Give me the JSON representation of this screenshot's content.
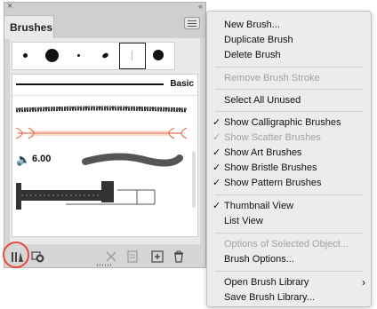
{
  "panel": {
    "tab_label": "Brushes",
    "basic_label": "Basic",
    "stroke_size": "6.00"
  },
  "menu": {
    "items": [
      {
        "label": "New Brush...",
        "enabled": true,
        "checked": false
      },
      {
        "label": "Duplicate Brush",
        "enabled": true,
        "checked": false
      },
      {
        "label": "Delete Brush",
        "enabled": true,
        "checked": false
      },
      {
        "label": "Remove Brush Stroke",
        "enabled": false,
        "checked": false
      },
      {
        "label": "Select All Unused",
        "enabled": true,
        "checked": false
      },
      {
        "label": "Show Calligraphic Brushes",
        "enabled": true,
        "checked": true
      },
      {
        "label": "Show Scatter Brushes",
        "enabled": false,
        "checked": true
      },
      {
        "label": "Show Art Brushes",
        "enabled": true,
        "checked": true
      },
      {
        "label": "Show Bristle Brushes",
        "enabled": true,
        "checked": true
      },
      {
        "label": "Show Pattern Brushes",
        "enabled": true,
        "checked": true
      },
      {
        "label": "Thumbnail View",
        "enabled": true,
        "checked": true
      },
      {
        "label": "List View",
        "enabled": true,
        "checked": false
      },
      {
        "label": "Options of Selected Object...",
        "enabled": false,
        "checked": false
      },
      {
        "label": "Brush Options...",
        "enabled": true,
        "checked": false
      },
      {
        "label": "Open Brush Library",
        "enabled": true,
        "checked": false,
        "submenu": true
      },
      {
        "label": "Save Brush Library...",
        "enabled": true,
        "checked": false
      }
    ],
    "check_glyph": "✓",
    "submenu_glyph": "›"
  },
  "colors": {
    "highlight": "#e8493a",
    "scatter_accent": "#e8704a"
  }
}
